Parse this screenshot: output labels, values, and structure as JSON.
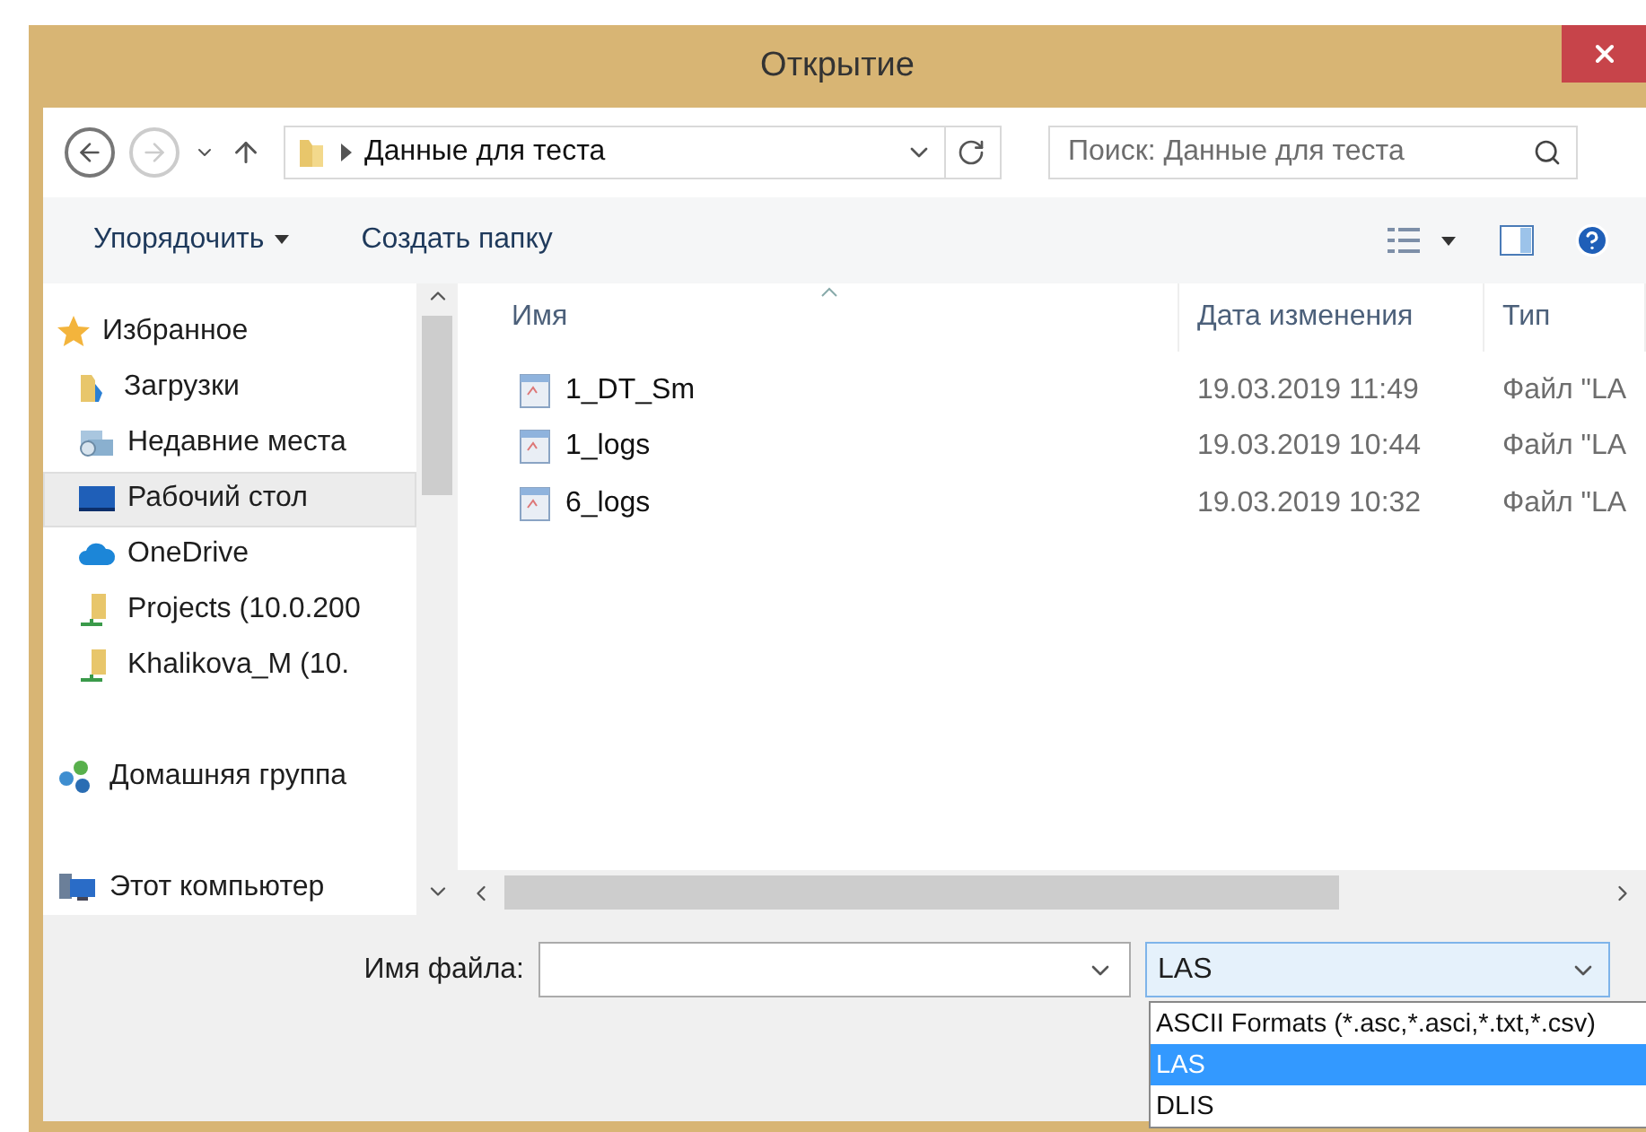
{
  "window": {
    "title": "Открытие"
  },
  "navigation": {
    "path": "Данные для теста",
    "search": {
      "placeholder": "Поиск: Данные для теста"
    }
  },
  "toolbar": {
    "buttons": [
      "Упорядочить",
      "Создать папку"
    ]
  },
  "sidebar": {
    "items": [
      {
        "label": "Избранное",
        "kind": "favorites",
        "selected": false,
        "children": [
          {
            "label": "Загрузки",
            "kind": "downloads",
            "selected": false
          },
          {
            "label": "Недавние места",
            "kind": "recent",
            "selected": false
          },
          {
            "label": "Рабочий стол",
            "kind": "desktop",
            "selected": true
          },
          {
            "label": "OneDrive",
            "kind": "cloud",
            "selected": false
          },
          {
            "label": "Projects (10.0.200",
            "kind": "network",
            "selected": false
          },
          {
            "label": "Khalikova_M (10.",
            "kind": "network",
            "selected": false
          }
        ]
      },
      {
        "label": "Домашняя группа",
        "kind": "homegroup",
        "selected": false
      },
      {
        "label": "Этот компьютер",
        "kind": "computer",
        "selected": false
      }
    ]
  },
  "table": {
    "columns": [
      "Имя",
      "Дата изменения",
      "Тип"
    ],
    "rows": [
      {
        "name": "1_DT_Sm",
        "date": "19.03.2019 11:49",
        "type": "Файл \"LA"
      },
      {
        "name": "1_logs",
        "date": "19.03.2019 10:44",
        "type": "Файл \"LA"
      },
      {
        "name": "6_logs",
        "date": "19.03.2019 10:32",
        "type": "Файл \"LA"
      }
    ]
  },
  "footer": {
    "filename_label": "Имя файла:",
    "filter": {
      "value": "LAS",
      "expanded": true,
      "options": [
        {
          "label": "ASCII Formats (*.asc,*.asci,*.txt,*.csv)",
          "selected": false
        },
        {
          "label": "LAS",
          "selected": true
        },
        {
          "label": "DLIS",
          "selected": false
        }
      ]
    }
  }
}
